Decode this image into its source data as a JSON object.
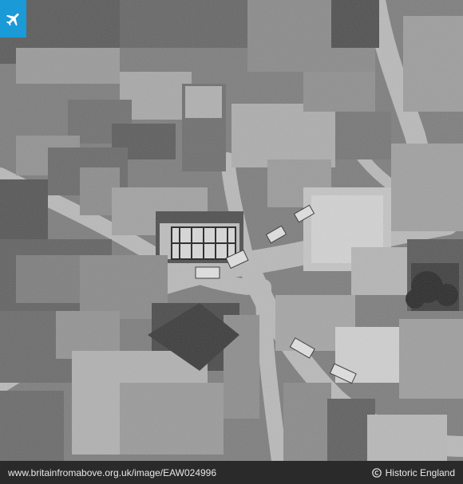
{
  "photo": {
    "subject": "Black and white oblique aerial photograph of a town centre with road junction, buses, shops and war-damaged clearance sites"
  },
  "badge": {
    "icon": "airplane-icon",
    "color": "#1a9ad6"
  },
  "footer": {
    "url": "www.britainfromabove.org.uk/image/EAW024996",
    "credit_icon": "copyright-icon",
    "credit": "Historic England"
  }
}
